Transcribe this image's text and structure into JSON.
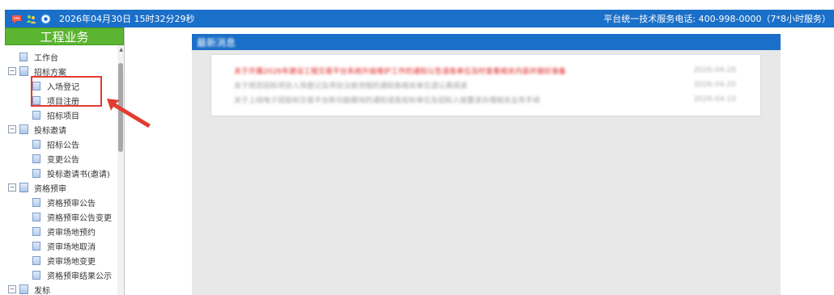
{
  "topbar": {
    "datetime": "2026年04月30日 15时32分29秒",
    "hotline": "平台统一技术服务电话: 400-998-0000（7*8小时服务）",
    "icons": [
      "chat-icon",
      "users-icon",
      "help-icon"
    ]
  },
  "sidebar": {
    "title": "工程业务",
    "items": [
      {
        "label": "工作台",
        "level": 0
      },
      {
        "label": "招标方案",
        "level": 1,
        "expander": "⊟"
      },
      {
        "label": "入场登记",
        "level": 2
      },
      {
        "label": "项目注册",
        "level": 2
      },
      {
        "label": "招标项目",
        "level": 2
      },
      {
        "label": "投标邀请",
        "level": 1,
        "expander": "⊟"
      },
      {
        "label": "招标公告",
        "level": 2
      },
      {
        "label": "变更公告",
        "level": 2
      },
      {
        "label": "投标邀请书(邀请)",
        "level": 2
      },
      {
        "label": "资格预审",
        "level": 1,
        "expander": "⊟"
      },
      {
        "label": "资格预审公告",
        "level": 2
      },
      {
        "label": "资格预审公告变更",
        "level": 2
      },
      {
        "label": "资审场地预约",
        "level": 2
      },
      {
        "label": "资审场地取消",
        "level": 2
      },
      {
        "label": "资审场地变更",
        "level": 2
      },
      {
        "label": "资格预审结果公示",
        "level": 2
      },
      {
        "label": "发标",
        "level": 1,
        "expander": "⊟"
      }
    ]
  },
  "news": {
    "title": "最新消息",
    "rows": [
      {
        "title": "关于开展2026年建设工程交易平台系统升级维护工作的通知公告请各单位及时查看相关内容并做好准备",
        "date": "2026-04-28",
        "highlight": true
      },
      {
        "title": "关于规范招标项目入场登记及项目注册流程的通知各相关单位请认真阅读",
        "date": "2026-04-20",
        "highlight": false
      },
      {
        "title": "关于上线电子招投标交易平台新功能模块的通知请各投标单位及招标人按要求办理相关业务手续",
        "date": "2026-04-10",
        "highlight": false
      }
    ]
  },
  "colors": {
    "topbar": "#1a6fc8",
    "sidebar_header": "#5cb531",
    "highlight": "#e23b30",
    "news_highlight": "#e02020"
  }
}
